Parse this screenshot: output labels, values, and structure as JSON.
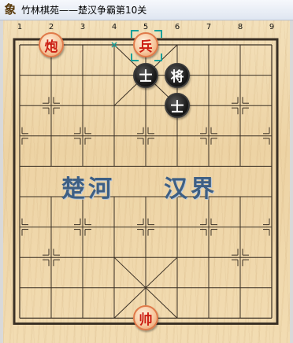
{
  "window": {
    "title": "竹林棋苑——楚汉争霸第10关",
    "icon": "xiangqi-app-icon",
    "icon_glyph": "象"
  },
  "board": {
    "column_labels": [
      "1",
      "2",
      "3",
      "4",
      "5",
      "6",
      "7",
      "8",
      "9"
    ],
    "river_left": "楚河",
    "river_right": "汉界",
    "last_move_from": {
      "col": 4,
      "row": 1
    },
    "selected": {
      "col": 5,
      "row": 1
    }
  },
  "pieces": [
    {
      "id": "red-cannon",
      "label": "炮",
      "side": "red",
      "col": 2,
      "row": 1
    },
    {
      "id": "red-soldier",
      "label": "兵",
      "side": "red",
      "col": 5,
      "row": 1
    },
    {
      "id": "black-advisor-1",
      "label": "士",
      "side": "black",
      "col": 5,
      "row": 2
    },
    {
      "id": "black-general",
      "label": "将",
      "side": "black",
      "col": 6,
      "row": 2
    },
    {
      "id": "black-advisor-2",
      "label": "士",
      "side": "black",
      "col": 6,
      "row": 3
    },
    {
      "id": "red-marshal",
      "label": "帅",
      "side": "red",
      "col": 5,
      "row": 10
    }
  ],
  "colors": {
    "red_piece_text": "#cc1e12",
    "black_piece_face": "#1c1c1c",
    "board_wood": "#f1dcb3",
    "grid_line": "#3a3025",
    "river_text": "#3e5f84",
    "selection_marker": "#19a09a"
  }
}
